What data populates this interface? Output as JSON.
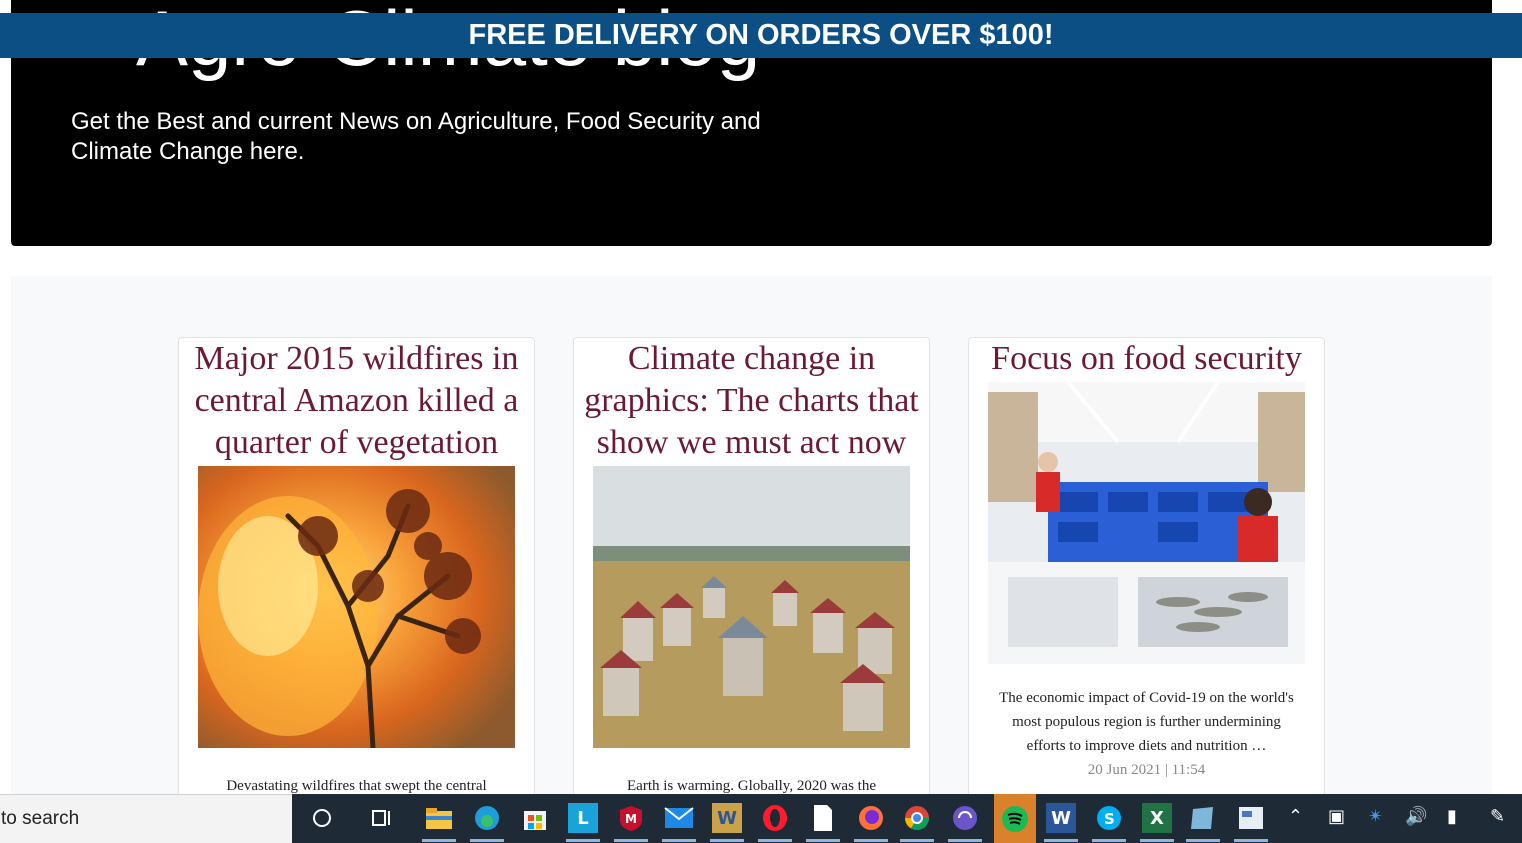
{
  "banner": {
    "text": "FREE DELIVERY ON ORDERS OVER $100!"
  },
  "hero": {
    "title": "Agro-Climate blog",
    "subtitle": "Get the Best and current News on Agriculture, Food Security and Climate Change here."
  },
  "cards": [
    {
      "title": "Major 2015 wildfires in central Amazon killed a quarter of vegetation",
      "text": "Devastating wildfires that swept the central"
    },
    {
      "title": "Climate change in graphics: The charts that show we must act now",
      "text": "Earth is warming. Globally, 2020 was the"
    },
    {
      "title": "Focus on food security",
      "text": "The economic impact of Covid-19 on the world's most populous region is further undermining efforts to improve diets and nutrition …",
      "meta": "20 Jun 2021 | 11:54"
    }
  ],
  "taskbar": {
    "search_text": "to search",
    "apps": [
      "cortana",
      "task-view",
      "file-explorer",
      "edge",
      "store",
      "l-app",
      "mcafee",
      "mail",
      "word-pad",
      "opera",
      "file",
      "firefox",
      "chrome",
      "app-swirl",
      "spotify",
      "word",
      "skype",
      "excel",
      "notes",
      "mail-alt"
    ],
    "tray": [
      "chevron-up",
      "meet",
      "bluetooth",
      "volume",
      "battery",
      "pen"
    ]
  },
  "colors": {
    "banner_bg": "#0b4f85",
    "title_color": "#6b1a33",
    "hero_bg": "#000000",
    "taskbar_bg": "#1f2a37"
  }
}
